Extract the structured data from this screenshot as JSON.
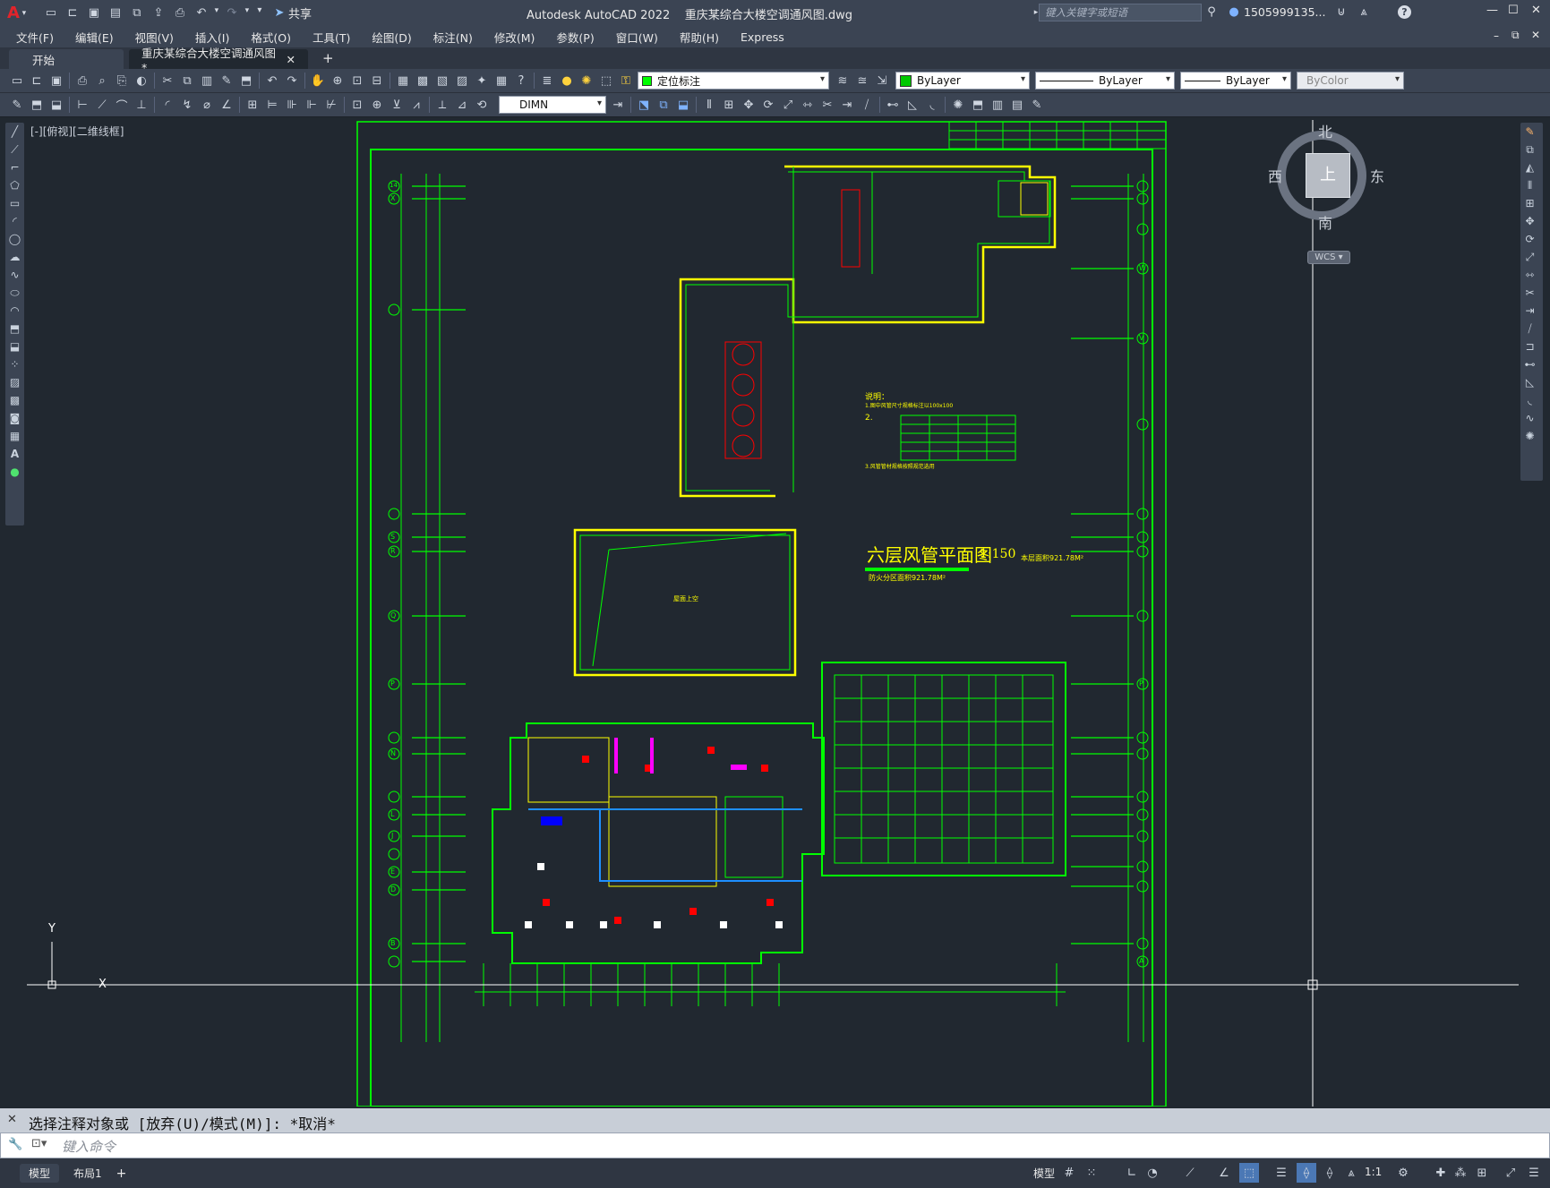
{
  "titlebar": {
    "app_logo": "A",
    "share_label": "共享",
    "title": "Autodesk AutoCAD 2022    重庆某综合大楼空调通风图.dwg",
    "search_placeholder": "键入关键字或短语",
    "user": "1505999135...",
    "minimize": "—",
    "maximize": "☐",
    "close": "✕"
  },
  "menu": [
    "文件(F)",
    "编辑(E)",
    "视图(V)",
    "插入(I)",
    "格式(O)",
    "工具(T)",
    "绘图(D)",
    "标注(N)",
    "修改(M)",
    "参数(P)",
    "窗口(W)",
    "帮助(H)",
    "Express"
  ],
  "tabs": {
    "start": "开始",
    "drawing": "重庆某综合大楼空调通风图*",
    "close": "✕",
    "add": "+"
  },
  "toolbar": {
    "layer_name": "定位标注",
    "color": "ByLayer",
    "linetype": "ByLayer",
    "lineweight": "ByLayer",
    "plotstyle": "ByColor",
    "dimstyle": "DIMN"
  },
  "viewport": {
    "label": "[-][俯视][二维线框]",
    "compass": {
      "north": "北",
      "south": "南",
      "east": "东",
      "west": "西",
      "top": "上",
      "wcs": "WCS"
    },
    "ucs_x": "X",
    "ucs_y": "Y"
  },
  "drawing": {
    "title": "六层风管平面图",
    "scale": "1:150",
    "area": "本层面积921.78M²",
    "area2": "防火分区面积921.78M²",
    "notes_title": "说明：",
    "notes_line1": "1.图中风管尺寸规格标注以100x100",
    "notes_line2": "2.",
    "notes_line3": "3.风管管材规格按照规范选用",
    "room_label": "屋面上空",
    "rows": [
      "14",
      "X",
      "W",
      "V",
      "U",
      "S",
      "R",
      "Q",
      "P",
      "O",
      "N",
      "M",
      "L",
      "K",
      "J",
      "H",
      "G",
      "F",
      "E",
      "D",
      "C",
      "B",
      "A"
    ]
  },
  "command": {
    "history": "选择注释对象或 [放弃(U)/模式(M)]: *取消*",
    "placeholder": "键入命令"
  },
  "status": {
    "tab_model": "模型",
    "tab_layout": "布局1",
    "add": "+",
    "model_label": "模型",
    "scale": "1:1"
  },
  "colors": {
    "accent_red": "#c0272d",
    "cad_green": "#00ff00",
    "cad_yellow": "#ffff00",
    "cad_red": "#ff0000",
    "cad_magenta": "#ff00ff",
    "bg": "#212830"
  }
}
